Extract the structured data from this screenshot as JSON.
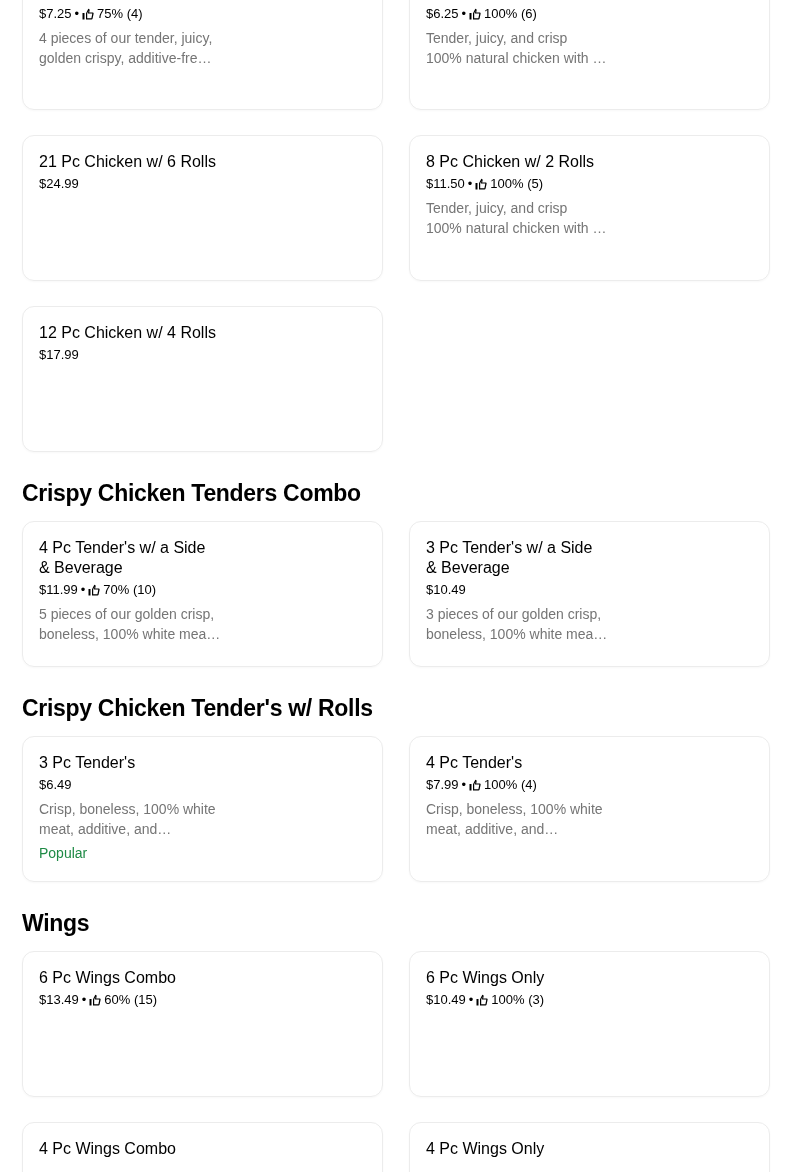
{
  "sections": [
    {
      "items": [
        {
          "price": "$7.25",
          "separator": "•",
          "rating": "75% (4)",
          "description_lines": [
            "4 pieces of our tender, juicy,",
            "golden crispy, additive-fre…"
          ]
        },
        {
          "price": "$6.25",
          "separator": "•",
          "rating": "100% (6)",
          "description_lines": [
            "Tender, juicy, and crisp",
            "100% natural chicken with …"
          ]
        },
        {
          "title_lines": [
            "21 Pc Chicken w/ 6 Rolls"
          ],
          "price": "$24.99"
        },
        {
          "title_lines": [
            "8 Pc Chicken w/ 2 Rolls"
          ],
          "price": "$11.50",
          "separator": "•",
          "rating": "100% (5)",
          "description_lines": [
            "Tender, juicy, and crisp",
            "100% natural chicken with …"
          ]
        },
        {
          "title_lines": [
            "12 Pc Chicken w/ 4 Rolls"
          ],
          "price": "$17.99"
        }
      ]
    },
    {
      "heading": "Crispy Chicken Tenders Combo",
      "items": [
        {
          "title_lines": [
            "4 Pc Tender's w/ a Side",
            "& Beverage"
          ],
          "price": "$11.99",
          "separator": "•",
          "rating": "70% (10)",
          "description_lines": [
            "5 pieces of our golden crisp,",
            "boneless, 100% white mea…"
          ]
        },
        {
          "title_lines": [
            "3 Pc Tender's w/ a Side",
            "& Beverage"
          ],
          "price": "$10.49",
          "description_lines": [
            "3 pieces of our golden crisp,",
            "boneless, 100% white mea…"
          ]
        }
      ]
    },
    {
      "heading": "Crispy Chicken Tender's w/ Rolls",
      "items": [
        {
          "title_lines": [
            "3 Pc Tender's"
          ],
          "price": "$6.49",
          "description_lines": [
            "Crisp, boneless, 100% white",
            "meat, additive, and…"
          ],
          "badge": "Popular"
        },
        {
          "title_lines": [
            "4 Pc Tender's"
          ],
          "price": "$7.99",
          "separator": "•",
          "rating": "100% (4)",
          "description_lines": [
            "Crisp, boneless, 100% white",
            "meat, additive, and…"
          ]
        }
      ]
    },
    {
      "heading": "Wings",
      "items": [
        {
          "title_lines": [
            "6 Pc Wings Combo"
          ],
          "price": "$13.49",
          "separator": "•",
          "rating": "60% (15)"
        },
        {
          "title_lines": [
            "6 Pc Wings Only"
          ],
          "price": "$10.49",
          "separator": "•",
          "rating": "100% (3)"
        },
        {
          "title_lines": [
            "4 Pc Wings Combo"
          ]
        },
        {
          "title_lines": [
            "4 Pc Wings Only"
          ]
        }
      ]
    }
  ]
}
